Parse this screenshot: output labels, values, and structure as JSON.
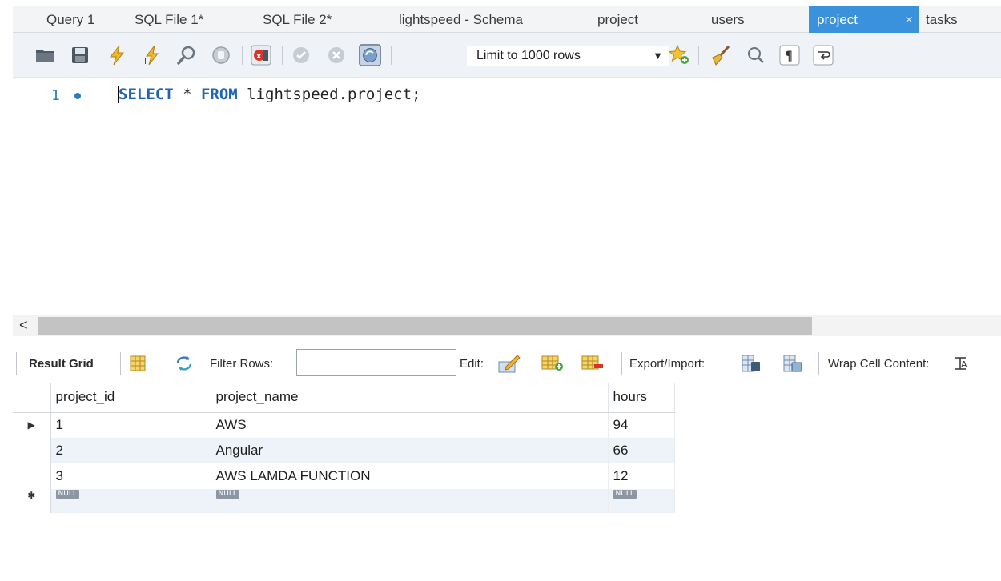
{
  "tabs": [
    {
      "label": "Query 1"
    },
    {
      "label": "SQL File 1*"
    },
    {
      "label": "SQL File 2*"
    },
    {
      "label": "lightspeed - Schema"
    },
    {
      "label": "project"
    },
    {
      "label": "users"
    },
    {
      "label": "project",
      "active": true
    },
    {
      "label": "tasks"
    }
  ],
  "tab_close_glyph": "×",
  "toolbar": {
    "icons": [
      "open-folder-icon",
      "save-icon",
      "execute-icon",
      "execute-current-icon",
      "explain-icon",
      "stop-icon",
      "toggle-error-icon",
      "commit-icon",
      "rollback-icon",
      "autocommit-icon"
    ],
    "limit_label": "Limit to 1000 rows",
    "right_icons": [
      "add-snippet-icon",
      "beautify-icon",
      "find-icon",
      "invisible-chars-icon",
      "wrap-lines-icon"
    ]
  },
  "editor": {
    "line_number": "1",
    "sql": {
      "kw1": "SELECT",
      "star": " * ",
      "kw2": "FROM",
      "rest": " lightspeed.project;"
    }
  },
  "result_toolbar": {
    "result_grid_label": "Result Grid",
    "filter_label": "Filter Rows:",
    "filter_value": "",
    "edit_label": "Edit:",
    "export_label": "Export/Import:",
    "wrap_label": "Wrap Cell Content:"
  },
  "grid": {
    "columns": [
      "project_id",
      "project_name",
      "hours"
    ],
    "rows": [
      {
        "project_id": "1",
        "project_name": "AWS",
        "hours": "94"
      },
      {
        "project_id": "2",
        "project_name": "Angular",
        "hours": "66"
      },
      {
        "project_id": "3",
        "project_name": "AWS LAMDA FUNCTION",
        "hours": "12"
      }
    ],
    "null_label": "NULL",
    "current_row_marker": "▶",
    "new_row_marker": "✱"
  },
  "colors": {
    "active_tab": "#3a92dd",
    "keyword": "#1f64b8",
    "line_number": "#2b7bbf",
    "alt_row": "#eef3f9"
  }
}
